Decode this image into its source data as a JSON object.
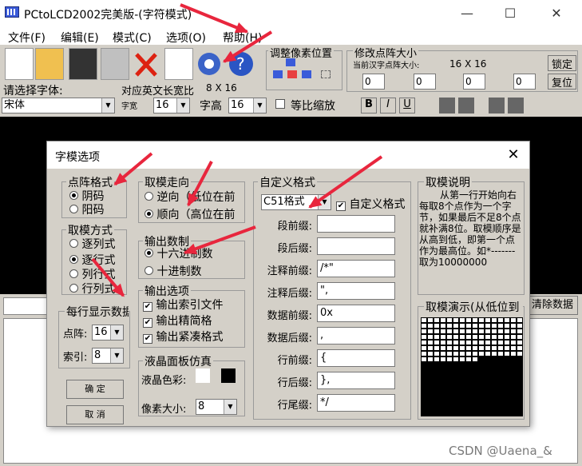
{
  "app": {
    "title": "PCtoLCD2002完美版-(字符模式)"
  },
  "window_controls": {
    "minimize": "—",
    "maximize": "☐",
    "close": "✕"
  },
  "menu": [
    "文件(F)",
    "编辑(E)",
    "模式(C)",
    "选项(O)",
    "帮助(H)"
  ],
  "toolbar": {
    "adjust_group": "调整像素位置",
    "size_group": "修改点阵大小",
    "current_size_label": "当前汉字点阵大小:",
    "current_size": "16 X 16",
    "lock_button": "锁定",
    "restore_button": "复位",
    "spin_values": [
      "0",
      "0",
      "0",
      "0"
    ]
  },
  "font_row": {
    "prompt": "请选择字体:",
    "ratio_label": "对应英文长宽比",
    "ratio_value": "8 X 16",
    "font_value": "宋体",
    "width_label": "字宽",
    "width_value": "16",
    "height_label": "字高",
    "height_value": "16",
    "scale_label": "等比缩放",
    "bold": "B",
    "italic": "I",
    "underline": "U"
  },
  "lower": {
    "clear_button": "清除数据"
  },
  "dialog": {
    "title": "字模选项",
    "close": "✕",
    "dot_format": {
      "legend": "点阵格式",
      "options": [
        "阴码",
        "阳码"
      ],
      "selected": 0
    },
    "mode": {
      "legend": "取模方式",
      "options": [
        "逐列式",
        "逐行式",
        "列行式",
        "行列式"
      ],
      "selected": 1
    },
    "per_line": {
      "legend": "每行显示数据",
      "dot_label": "点阵:",
      "dot_value": "16",
      "index_label": "索引:",
      "index_value": "8"
    },
    "ok_button": "确  定",
    "cancel_button": "取  消",
    "direction": {
      "legend": "取模走向",
      "options": [
        "逆向（低位在前",
        "顺向（高位在前"
      ],
      "selected": 1
    },
    "numbase": {
      "legend": "输出数制",
      "options": [
        "十六进制数",
        "十进制数"
      ],
      "selected": 0
    },
    "output": {
      "legend": "输出选项",
      "options": [
        "输出索引文件",
        "输出精简格",
        "输出紧凑格式"
      ]
    },
    "lcd": {
      "legend": "液晶面板仿真",
      "color_label": "液晶色彩:",
      "pixel_label": "像素大小:",
      "pixel_value": "8"
    },
    "custom": {
      "legend": "自定义格式",
      "select": "C51格式",
      "checkbox_label": "自定义格式",
      "fields": [
        {
          "label": "段前缀:",
          "value": ""
        },
        {
          "label": "段后缀:",
          "value": ""
        },
        {
          "label": "注释前缀:",
          "value": "/*\""
        },
        {
          "label": "注释后缀:",
          "value": "\","
        },
        {
          "label": "数据前缀:",
          "value": "0x"
        },
        {
          "label": "数据后缀:",
          "value": ","
        },
        {
          "label": "行前缀:",
          "value": "{"
        },
        {
          "label": "行后缀:",
          "value": "},"
        },
        {
          "label": "行尾缀:",
          "value": "*/"
        }
      ]
    },
    "explain": {
      "legend": "取模说明",
      "text": "从第一行开始向右每取8个点作为一个字节，如果最后不足8个点就补满8位。取模顺序是从高到低，即第一个点作为最高位。如*-------取为10000000"
    },
    "demo": {
      "legend": "取模演示(从低位到"
    }
  },
  "watermark": "CSDN @Uaena_&",
  "colors": {
    "arrow": "#e8263d",
    "window": "#d4d0c8"
  }
}
